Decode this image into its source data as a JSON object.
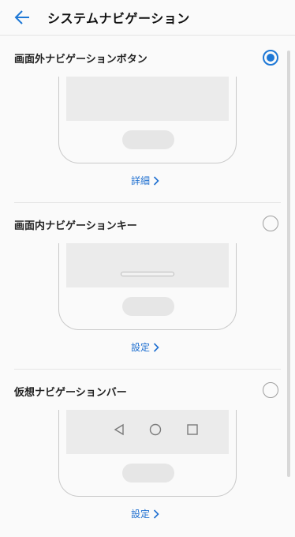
{
  "header": {
    "title": "システムナビゲーション"
  },
  "options": [
    {
      "label": "画面外ナビゲーションボタン",
      "selected": true,
      "link_label": "詳細"
    },
    {
      "label": "画面内ナビゲーションキー",
      "selected": false,
      "link_label": "設定"
    },
    {
      "label": "仮想ナビゲーションバー",
      "selected": false,
      "link_label": "設定"
    }
  ],
  "colors": {
    "accent": "#1e78d6",
    "link": "#1e6fd0"
  },
  "icons": {
    "back": "arrow-left-icon",
    "nav_back": "triangle-back-icon",
    "nav_home": "circle-home-icon",
    "nav_recent": "square-recent-icon",
    "link_chevron": "chevron-right-icon"
  }
}
